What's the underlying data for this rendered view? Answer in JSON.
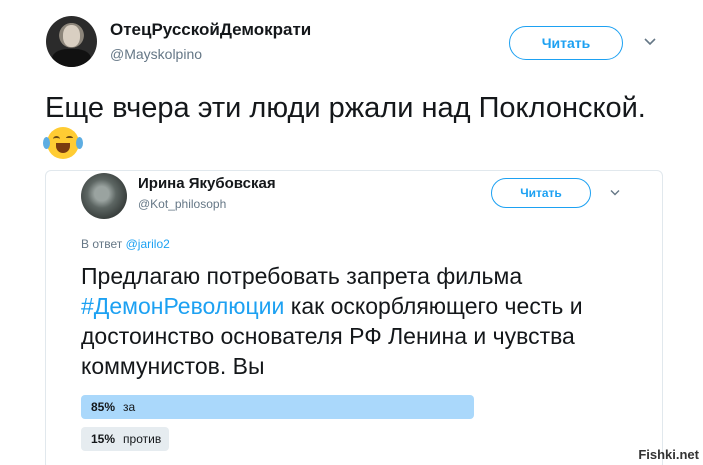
{
  "tweet": {
    "author_name": "ОтецРусскойДемократи",
    "author_handle": "@Mayskolpino",
    "follow_label": "Читать",
    "text": "Еще вчера эти люди ржали над Поклонской.",
    "emoji_icon": "face-with-tears-of-joy-icon"
  },
  "quoted": {
    "author_name": "Ирина Якубовская",
    "author_handle": "@Kot_philosoph",
    "follow_label": "Читать",
    "reply_prefix": "В ответ",
    "reply_mention": "@jarilo2",
    "text_before": "Предлагаю потребовать запрета фильма ",
    "hashtag": "#ДемонРеволюции",
    "text_after": " как оскорбляющего честь и достоинство основателя РФ Ленина и чувства коммунистов. Вы",
    "poll": [
      {
        "percent_label": "85%",
        "option": "за",
        "percent": 85,
        "winner": true
      },
      {
        "percent_label": "15%",
        "option": "против",
        "percent": 15,
        "winner": false
      }
    ]
  },
  "watermark": "Fishki.net",
  "colors": {
    "accent": "#1da1f2",
    "text": "#14171a",
    "muted": "#657786",
    "poll_winner": "#aad8fb",
    "poll_other": "#e6ecf0"
  }
}
